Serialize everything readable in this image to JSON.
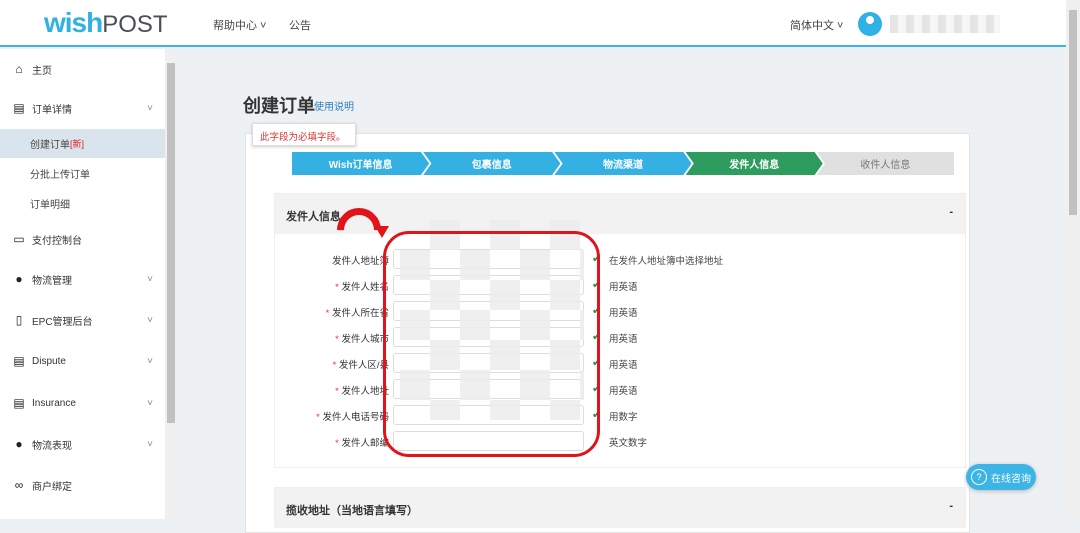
{
  "header": {
    "logo": "wish",
    "logo_suffix": "POST",
    "nav": [
      "帮助中心 ˅",
      "公告"
    ],
    "language": "简体中文 ˅"
  },
  "sidebar": {
    "items": [
      {
        "label": "主页",
        "icon": "home-icon"
      },
      {
        "label": "订单详情",
        "icon": "clipboard-icon"
      },
      {
        "label": "创建订单",
        "badge": "[新]"
      },
      {
        "label": "分批上传订单"
      },
      {
        "label": "订单明细"
      },
      {
        "label": "支付控制台",
        "icon": "card-icon"
      },
      {
        "label": "物流管理",
        "icon": "globe-icon"
      },
      {
        "label": "EPC管理后台",
        "icon": "epc-icon"
      },
      {
        "label": "Dispute",
        "icon": "clipboard-icon"
      },
      {
        "label": "Insurance",
        "icon": "clipboard-icon"
      },
      {
        "label": "物流表现",
        "icon": "globe-icon"
      },
      {
        "label": "商户绑定",
        "icon": "link-icon"
      }
    ]
  },
  "page": {
    "title": "创建订单",
    "help_link": "使用说明",
    "tooltip": "此字段为必填字段。"
  },
  "steps": [
    {
      "label": "Wish订单信息",
      "color": "#34b0e2"
    },
    {
      "label": "包裹信息",
      "color": "#34b0e2"
    },
    {
      "label": "物流渠道",
      "color": "#34b0e2"
    },
    {
      "label": "发件人信息",
      "color": "#2e9b5f"
    },
    {
      "label": "收件人信息",
      "color": "#e0e0e0"
    }
  ],
  "sender": {
    "title": "发件人信息",
    "collapse": "-",
    "fields": [
      {
        "label": "发件人地址簿",
        "required": false,
        "hint": "在发件人地址簿中选择地址",
        "valid": true
      },
      {
        "label": "发件人姓名",
        "required": true,
        "hint": "用英语",
        "valid": true
      },
      {
        "label": "发件人所在省",
        "required": true,
        "hint": "用英语",
        "valid": true
      },
      {
        "label": "发件人城市",
        "required": true,
        "hint": "用英语",
        "valid": true
      },
      {
        "label": "发件人区/县",
        "required": true,
        "hint": "用英语",
        "valid": true
      },
      {
        "label": "发件人地址",
        "required": true,
        "hint": "用英语",
        "valid": true
      },
      {
        "label": "发件人电话号码",
        "required": true,
        "hint": "用数字",
        "valid": true
      },
      {
        "label": "发件人邮编",
        "required": true,
        "hint": "英文数字",
        "valid": false
      }
    ]
  },
  "pickup": {
    "title": "揽收地址（当地语言填写）",
    "collapse": "-"
  },
  "chat": {
    "label": "在线咨询"
  }
}
